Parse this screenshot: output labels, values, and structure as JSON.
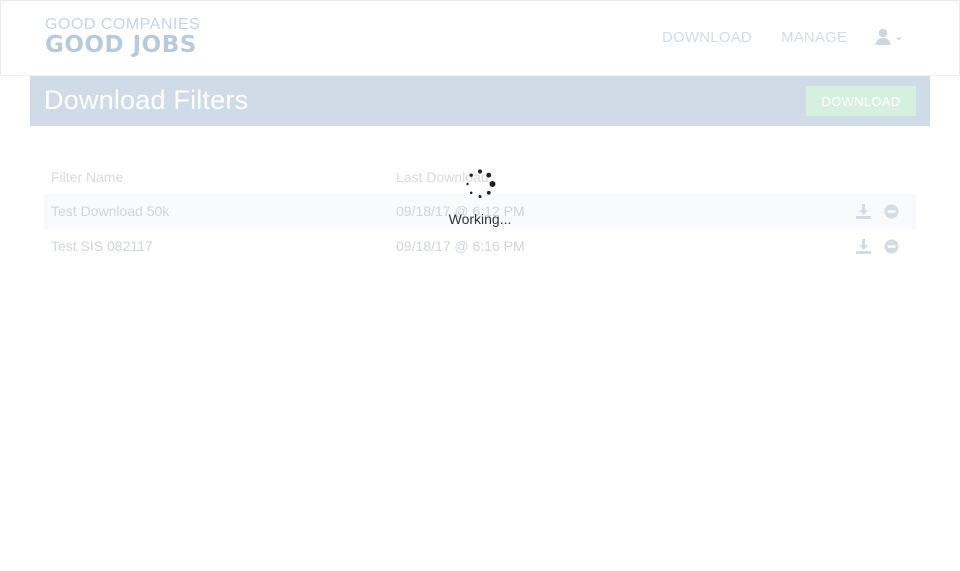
{
  "brand": {
    "line1": "GOOD COMPANIES",
    "line2": "GOOD JOBS"
  },
  "nav": {
    "download": "DOWNLOAD",
    "manage": "MANAGE",
    "user_icon": "user-icon"
  },
  "page": {
    "title": "Download Filters",
    "download_button": "DOWNLOAD"
  },
  "table": {
    "headers": {
      "name": "Filter Name",
      "last_download": "Last Download"
    },
    "rows": [
      {
        "name": "Test Download 50k",
        "last_download": "09/18/17 @ 6:12 PM"
      },
      {
        "name": "Test SIS 082117",
        "last_download": "09/18/17 @ 6:16 PM"
      }
    ],
    "row_actions": [
      "download-icon",
      "remove-icon"
    ]
  },
  "loading": {
    "text": "Working..."
  },
  "colors": {
    "title_bar": "#cfdbe6",
    "download_button": "#d6f0e0",
    "nav_link": "#d3dce6"
  }
}
